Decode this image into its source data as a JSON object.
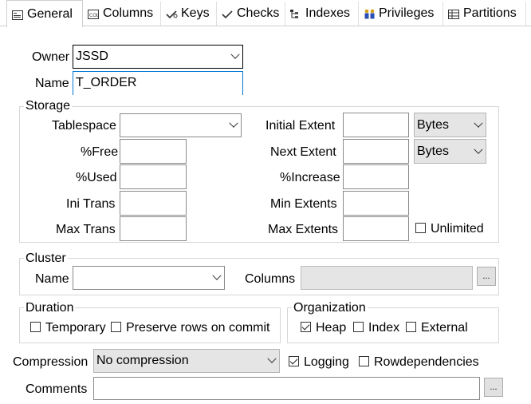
{
  "tabs": [
    {
      "label": "General",
      "icon": "general-icon"
    },
    {
      "label": "Columns",
      "icon": "columns-icon"
    },
    {
      "label": "Keys",
      "icon": "keys-icon"
    },
    {
      "label": "Checks",
      "icon": "checks-icon"
    },
    {
      "label": "Indexes",
      "icon": "indexes-icon"
    },
    {
      "label": "Privileges",
      "icon": "privileges-icon"
    },
    {
      "label": "Partitions",
      "icon": "partitions-icon"
    }
  ],
  "general": {
    "owner_label": "Owner",
    "owner_value": "JSSD",
    "name_label": "Name",
    "name_value": "T_ORDER"
  },
  "storage": {
    "title": "Storage",
    "tablespace_label": "Tablespace",
    "tablespace_value": "",
    "free_label": "%Free",
    "used_label": "%Used",
    "initrans_label": "Ini Trans",
    "maxtrans_label": "Max Trans",
    "initial_extent_label": "Initial Extent",
    "next_extent_label": "Next Extent",
    "increase_label": "%Increase",
    "min_extents_label": "Min Extents",
    "max_extents_label": "Max Extents",
    "initial_unit": "Bytes",
    "next_unit": "Bytes",
    "unlimited_label": "Unlimited",
    "unlimited_checked": false
  },
  "cluster": {
    "title": "Cluster",
    "name_label": "Name",
    "name_value": "",
    "columns_label": "Columns",
    "columns_value": "",
    "ellipsis": "..."
  },
  "duration": {
    "title": "Duration",
    "temporary_label": "Temporary",
    "preserve_label": "Preserve rows on commit"
  },
  "organization": {
    "title": "Organization",
    "heap_label": "Heap",
    "index_label": "Index",
    "external_label": "External",
    "heap_checked": true
  },
  "compression": {
    "label": "Compression",
    "value": "No compression",
    "logging_label": "Logging",
    "logging_checked": true,
    "rowdep_label": "Rowdependencies"
  },
  "comments": {
    "label": "Comments",
    "value": "",
    "ellipsis": "..."
  }
}
